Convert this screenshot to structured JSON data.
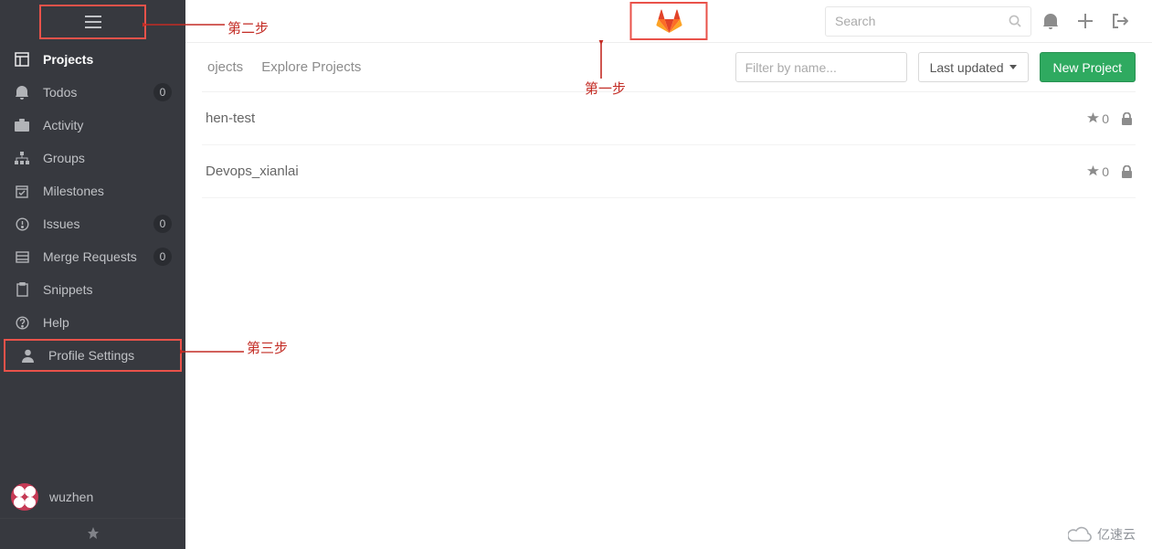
{
  "sidebar": {
    "items": [
      {
        "name": "projects",
        "label": "Projects",
        "active": true,
        "badge": null,
        "icon": "dashboard-icon"
      },
      {
        "name": "todos",
        "label": "Todos",
        "active": false,
        "badge": "0",
        "icon": "bell-icon"
      },
      {
        "name": "activity",
        "label": "Activity",
        "active": false,
        "badge": null,
        "icon": "briefcase-icon"
      },
      {
        "name": "groups",
        "label": "Groups",
        "active": false,
        "badge": null,
        "icon": "sitemap-icon"
      },
      {
        "name": "milestones",
        "label": "Milestones",
        "active": false,
        "badge": null,
        "icon": "calendar-icon"
      },
      {
        "name": "issues",
        "label": "Issues",
        "active": false,
        "badge": "0",
        "icon": "exclamation-icon"
      },
      {
        "name": "merge-requests",
        "label": "Merge Requests",
        "active": false,
        "badge": "0",
        "icon": "tasks-icon"
      },
      {
        "name": "snippets",
        "label": "Snippets",
        "active": false,
        "badge": null,
        "icon": "clipboard-icon"
      },
      {
        "name": "help",
        "label": "Help",
        "active": false,
        "badge": null,
        "icon": "question-icon"
      },
      {
        "name": "profile-settings",
        "label": "Profile Settings",
        "active": false,
        "badge": null,
        "icon": "user-icon",
        "framed": true
      }
    ],
    "user": {
      "name": "wuzhen"
    }
  },
  "topbar": {
    "search_placeholder": "Search"
  },
  "subbar": {
    "tabs": [
      {
        "name": "your-projects",
        "label": "ojects"
      },
      {
        "name": "explore-projects",
        "label": "Explore Projects"
      }
    ],
    "filter_placeholder": "Filter by name...",
    "sort_label": "Last updated",
    "new_project_label": "New Project"
  },
  "projects": [
    {
      "name": "hen-test",
      "stars": "0",
      "visibility": "private"
    },
    {
      "name": "Devops_xianlai",
      "stars": "0",
      "visibility": "private"
    }
  ],
  "annotations": {
    "step1": "第一步",
    "step2": "第二步",
    "step3": "第三步"
  },
  "watermark": "亿速云",
  "colors": {
    "red": "#e9524a",
    "green": "#2faa60",
    "sidebar": "#37393f"
  }
}
